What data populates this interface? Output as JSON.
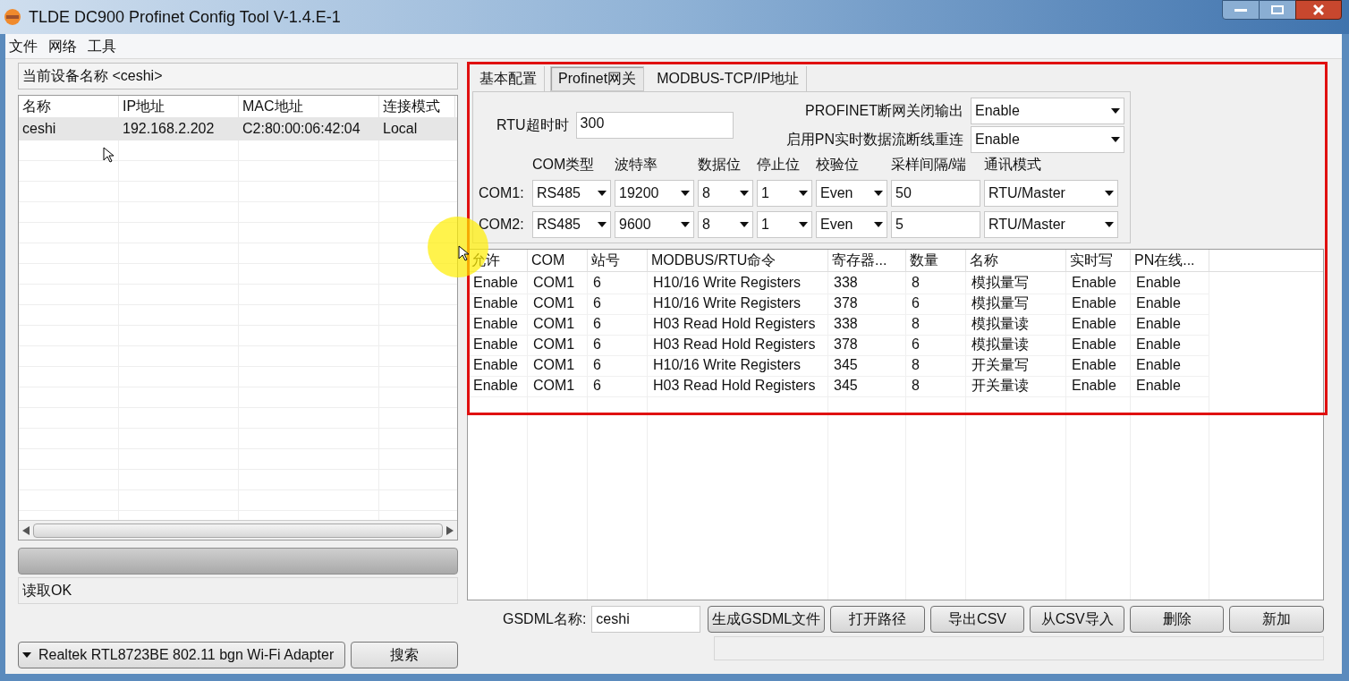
{
  "window": {
    "title": "TLDE DC900 Profinet Config Tool V-1.4.E-1"
  },
  "menu": [
    "文件",
    "网络",
    "工具"
  ],
  "left": {
    "device_label": "当前设备名称 <ceshi>",
    "device_table": {
      "columns": [
        "名称",
        "IP地址",
        "MAC地址",
        "连接模式"
      ],
      "rows": [
        {
          "cells": [
            "ceshi",
            "192.168.2.202",
            "C2:80:00:06:42:04",
            "Local"
          ],
          "selected": true
        }
      ]
    },
    "progress": {
      "level": 0
    },
    "status": "读取OK",
    "adapter": "Realtek RTL8723BE 802.11 bgn Wi-Fi Adapter",
    "search_button": "搜索"
  },
  "right": {
    "tabs": [
      {
        "label": "基本配置",
        "selected": false
      },
      {
        "label": "Profinet网关",
        "selected": true
      },
      {
        "label": "MODBUS-TCP/IP地址",
        "selected": false
      }
    ],
    "rtu_timeout": {
      "label": "RTU超时时",
      "value": "300"
    },
    "pn_close_output": {
      "label": "PROFINET断网关闭输出",
      "value": "Enable"
    },
    "pn_reconnect": {
      "label": "启用PN实时数据流断线重连",
      "value": "Enable"
    },
    "com_headers": [
      "COM类型",
      "波特率",
      "数据位",
      "停止位",
      "校验位",
      "采样间隔/端",
      "通讯模式"
    ],
    "com_rows": [
      {
        "label": "COM1:",
        "cells": [
          {
            "kind": "select",
            "value": "RS485"
          },
          {
            "kind": "select",
            "value": "19200"
          },
          {
            "kind": "select",
            "value": "8"
          },
          {
            "kind": "select",
            "value": "1"
          },
          {
            "kind": "select",
            "value": "Even"
          },
          {
            "kind": "input",
            "value": "50"
          },
          {
            "kind": "select",
            "value": "RTU/Master"
          }
        ]
      },
      {
        "label": "COM2:",
        "cells": [
          {
            "kind": "select",
            "value": "RS485"
          },
          {
            "kind": "select",
            "value": "9600"
          },
          {
            "kind": "select",
            "value": "8"
          },
          {
            "kind": "select",
            "value": "1"
          },
          {
            "kind": "select",
            "value": "Even"
          },
          {
            "kind": "input",
            "value": "5"
          },
          {
            "kind": "select",
            "value": "RTU/Master"
          }
        ]
      }
    ],
    "table": {
      "columns": [
        "允许",
        "COM",
        "站号",
        "MODBUS/RTU命令",
        "寄存器...",
        "数量",
        "名称",
        "实时写",
        "PN在线..."
      ],
      "rows": [
        [
          "Enable",
          "COM1",
          "6",
          "H10/16 Write Registers",
          "338",
          "8",
          "模拟量写",
          "Enable",
          "Enable"
        ],
        [
          "Enable",
          "COM1",
          "6",
          "H10/16 Write Registers",
          "378",
          "6",
          "模拟量写",
          "Enable",
          "Enable"
        ],
        [
          "Enable",
          "COM1",
          "6",
          "H03 Read Hold Registers",
          "338",
          "8",
          "模拟量读",
          "Enable",
          "Enable"
        ],
        [
          "Enable",
          "COM1",
          "6",
          "H03 Read Hold Registers",
          "378",
          "6",
          "模拟量读",
          "Enable",
          "Enable"
        ],
        [
          "Enable",
          "COM1",
          "6",
          "H10/16 Write Registers",
          "345",
          "8",
          "开关量写",
          "Enable",
          "Enable"
        ],
        [
          "Enable",
          "COM1",
          "6",
          "H03 Read Hold Registers",
          "345",
          "8",
          "开关量读",
          "Enable",
          "Enable"
        ]
      ]
    },
    "gsdml": {
      "label": "GSDML名称:",
      "value": "ceshi"
    },
    "buttons": [
      "生成GSDML文件",
      "打开路径",
      "导出CSV",
      "从CSV导入",
      "删除",
      "新加"
    ]
  }
}
